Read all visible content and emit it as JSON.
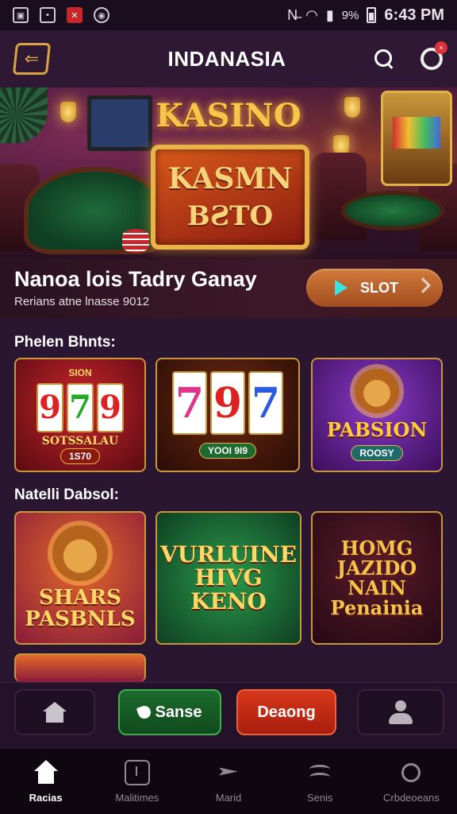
{
  "status_bar": {
    "battery": "9%",
    "time": "6:43 PM"
  },
  "app_bar": {
    "title": "INDANASIA"
  },
  "hero": {
    "title": "KASINO",
    "sign_line1": "KASMN",
    "sign_line2": "BƧTO"
  },
  "promo": {
    "title": "Nanoa lois Tadry Ganay",
    "subtitle": "Rerians atne lnasse 9012",
    "button_label": "SLOT"
  },
  "sections": [
    {
      "title": "Phelen Bhnts:",
      "tiles": [
        {
          "reels": [
            "9",
            "7",
            "9"
          ],
          "big": "SOTSSALAU",
          "small": "1S70",
          "top": "SION"
        },
        {
          "reels": [
            "7",
            "9",
            "7"
          ],
          "big": "",
          "small": "YOOI 9I9",
          "top": ""
        },
        {
          "reels": [],
          "big": "PABSION",
          "small": "ROOSY",
          "top": ""
        }
      ]
    },
    {
      "title": "Natelli Dabsol:",
      "tiles": [
        {
          "big": "SHARS\nPASBNLS"
        },
        {
          "big": "VURLUINE\nHIVG\nKENO"
        },
        {
          "big": "HOMG\nJAZIDO\nNAIN\nPenainia"
        }
      ]
    }
  ],
  "quick_actions": {
    "green_label": "Sanse",
    "red_label": "Deaong"
  },
  "bottom_nav": [
    {
      "label": "Racias",
      "icon": "home-icon"
    },
    {
      "label": "Malitimes",
      "icon": "clock-icon"
    },
    {
      "label": "Marid",
      "icon": "plane-icon"
    },
    {
      "label": "Senis",
      "icon": "waves-icon"
    },
    {
      "label": "Crbdeoeans",
      "icon": "bell-icon"
    }
  ],
  "colors": {
    "accent_gold": "#d9a441",
    "background": "#2a1630",
    "green": "#1d6b2e",
    "red": "#d6371a"
  }
}
